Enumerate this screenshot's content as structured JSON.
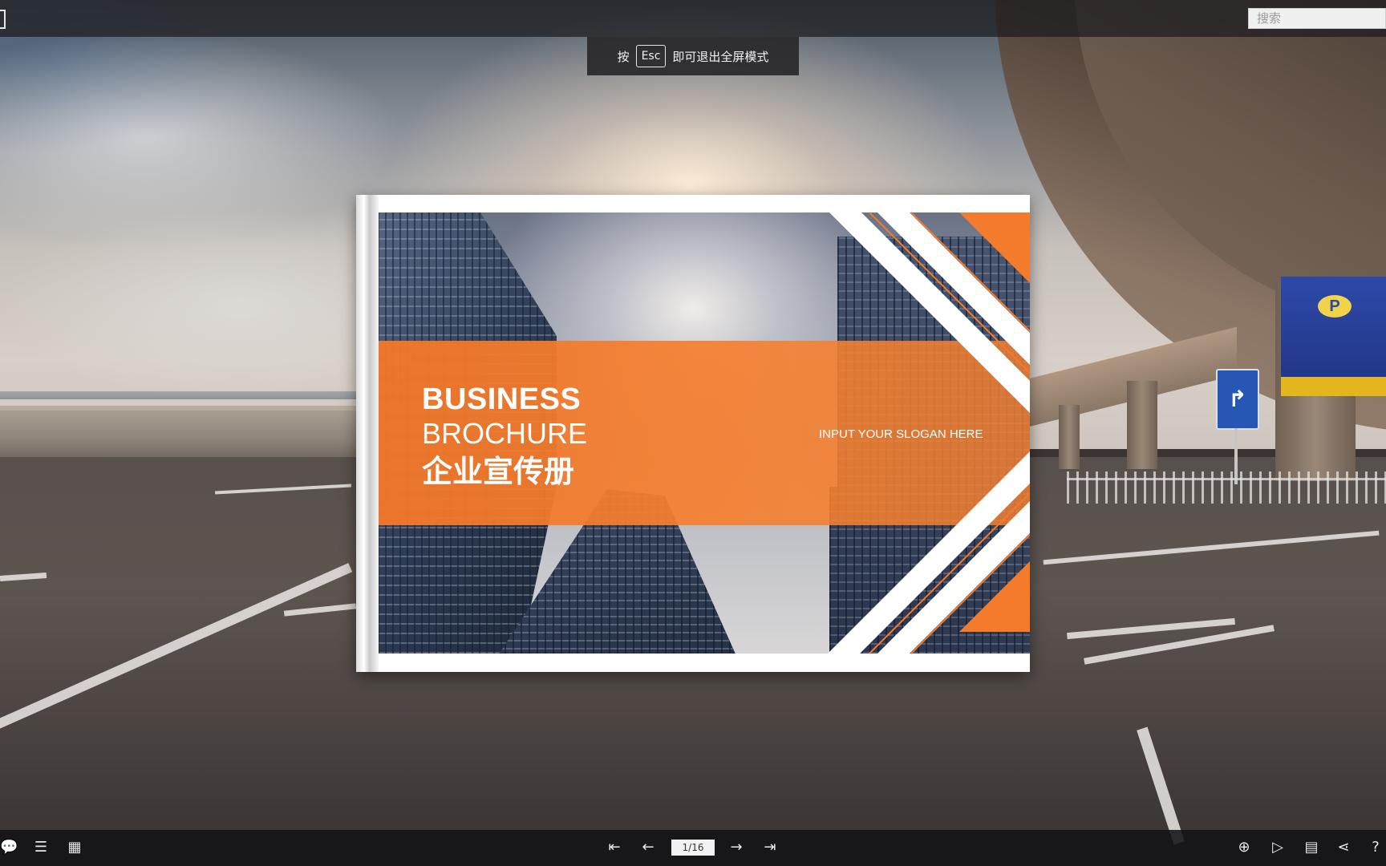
{
  "topbar": {
    "search_placeholder": "搜索"
  },
  "fullscreen_hint": {
    "prefix": "按",
    "key": "Esc",
    "suffix": "即可退出全屏模式"
  },
  "book": {
    "title_line1": "BUSINESS",
    "title_line2": "BROCHURE",
    "title_cn": "企业宣传册",
    "slogan": "INPUT YOUR SLOGAN HERE",
    "accent_color": "#f47a2c"
  },
  "background": {
    "parking_sign_letter": "P",
    "direction_sign_glyph": "↱"
  },
  "toolbar": {
    "left": [
      {
        "name": "comment-icon",
        "glyph": "💬"
      },
      {
        "name": "document-icon",
        "glyph": "☰"
      },
      {
        "name": "thumbnails-icon",
        "glyph": "▦"
      }
    ],
    "nav": {
      "first_glyph": "⇤",
      "prev_glyph": "←",
      "page_value": "1/16",
      "next_glyph": "→",
      "last_glyph": "⇥"
    },
    "right": [
      {
        "name": "zoom-in-icon",
        "glyph": "⊕"
      },
      {
        "name": "autoplay-icon",
        "glyph": "▷"
      },
      {
        "name": "book-view-icon",
        "glyph": "▤"
      },
      {
        "name": "share-icon",
        "glyph": "⋖"
      },
      {
        "name": "help-icon",
        "glyph": "?"
      }
    ]
  }
}
